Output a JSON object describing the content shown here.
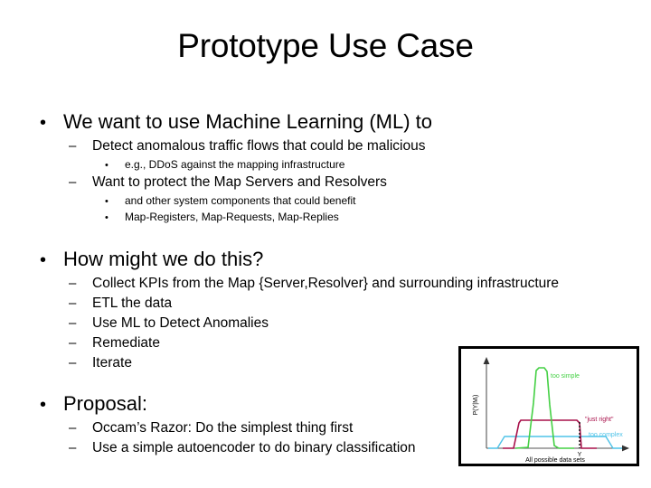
{
  "slide": {
    "title": "Prototype Use Case",
    "background_color": "#ffffff",
    "text_color": "#000000"
  },
  "content": {
    "groups": [
      {
        "items": [
          {
            "level": 1,
            "marker": "•",
            "text": "We want to use Machine Learning (ML) to"
          },
          {
            "level": 2,
            "marker": "–",
            "text": "Detect anomalous traffic flows that could be malicious"
          },
          {
            "level": 3,
            "marker": "•",
            "text": "e.g., DDoS against the mapping infrastructure"
          },
          {
            "level": 2,
            "marker": "–",
            "text": "Want to protect the Map Servers and Resolvers"
          },
          {
            "level": 3,
            "marker": "•",
            "text": "and other system components that could benefit"
          },
          {
            "level": 3,
            "marker": "•",
            "text": "Map-Registers, Map-Requests, Map-Replies"
          }
        ]
      },
      {
        "items": [
          {
            "level": 1,
            "marker": "•",
            "text": "How might we do this?"
          },
          {
            "level": 2,
            "marker": "–",
            "text": "Collect KPIs from the Map {Server,Resolver} and surrounding infrastructure"
          },
          {
            "level": 2,
            "marker": "–",
            "text": "ETL the data"
          },
          {
            "level": 2,
            "marker": "–",
            "text": "Use ML to Detect Anomalies"
          },
          {
            "level": 2,
            "marker": "–",
            "text": "Remediate"
          },
          {
            "level": 2,
            "marker": "–",
            "text": "Iterate"
          }
        ]
      },
      {
        "items": [
          {
            "level": 1,
            "marker": "•",
            "text": "Proposal:"
          },
          {
            "level": 2,
            "marker": "–",
            "text": "Occam’s Razor: Do the simplest thing first"
          },
          {
            "level": 2,
            "marker": "–",
            "text": "Use a simple autoencoder to do binary classification"
          }
        ]
      }
    ]
  },
  "chart_data": {
    "type": "line",
    "title": "",
    "xlabel": "All possible data sets",
    "ylabel": "P(Y|Mᵢ)",
    "xtick_labels": [
      "Y"
    ],
    "grid": false,
    "legend": "inline-annotations",
    "axis_color": "#555555",
    "border_color": "#000000",
    "series": [
      {
        "name": "too simple",
        "label": "too simple",
        "color": "#44d044",
        "description": "tall narrow peak centred slightly left of Y",
        "peak_height": 0.92,
        "center": 0.47,
        "width": 0.09
      },
      {
        "name": "just right",
        "label": "\"just right\"",
        "color": "#a8104a",
        "description": "medium-height wide plateau spanning the middle, truncated at Y by a dotted drop line",
        "peak_height": 0.34,
        "center": 0.45,
        "width": 0.34
      },
      {
        "name": "too complex",
        "label": "too complex",
        "color": "#4fc3e8",
        "description": "very wide low plateau spanning nearly the full x-range",
        "peak_height": 0.14,
        "center": 0.48,
        "width": 0.78
      }
    ],
    "annotations": [
      {
        "text": "too simple",
        "color": "#44d044"
      },
      {
        "text": "\"just right\"",
        "color": "#a8104a"
      },
      {
        "text": "too complex",
        "color": "#4fc3e8"
      },
      {
        "text": "Y",
        "color": "#000000"
      }
    ]
  }
}
